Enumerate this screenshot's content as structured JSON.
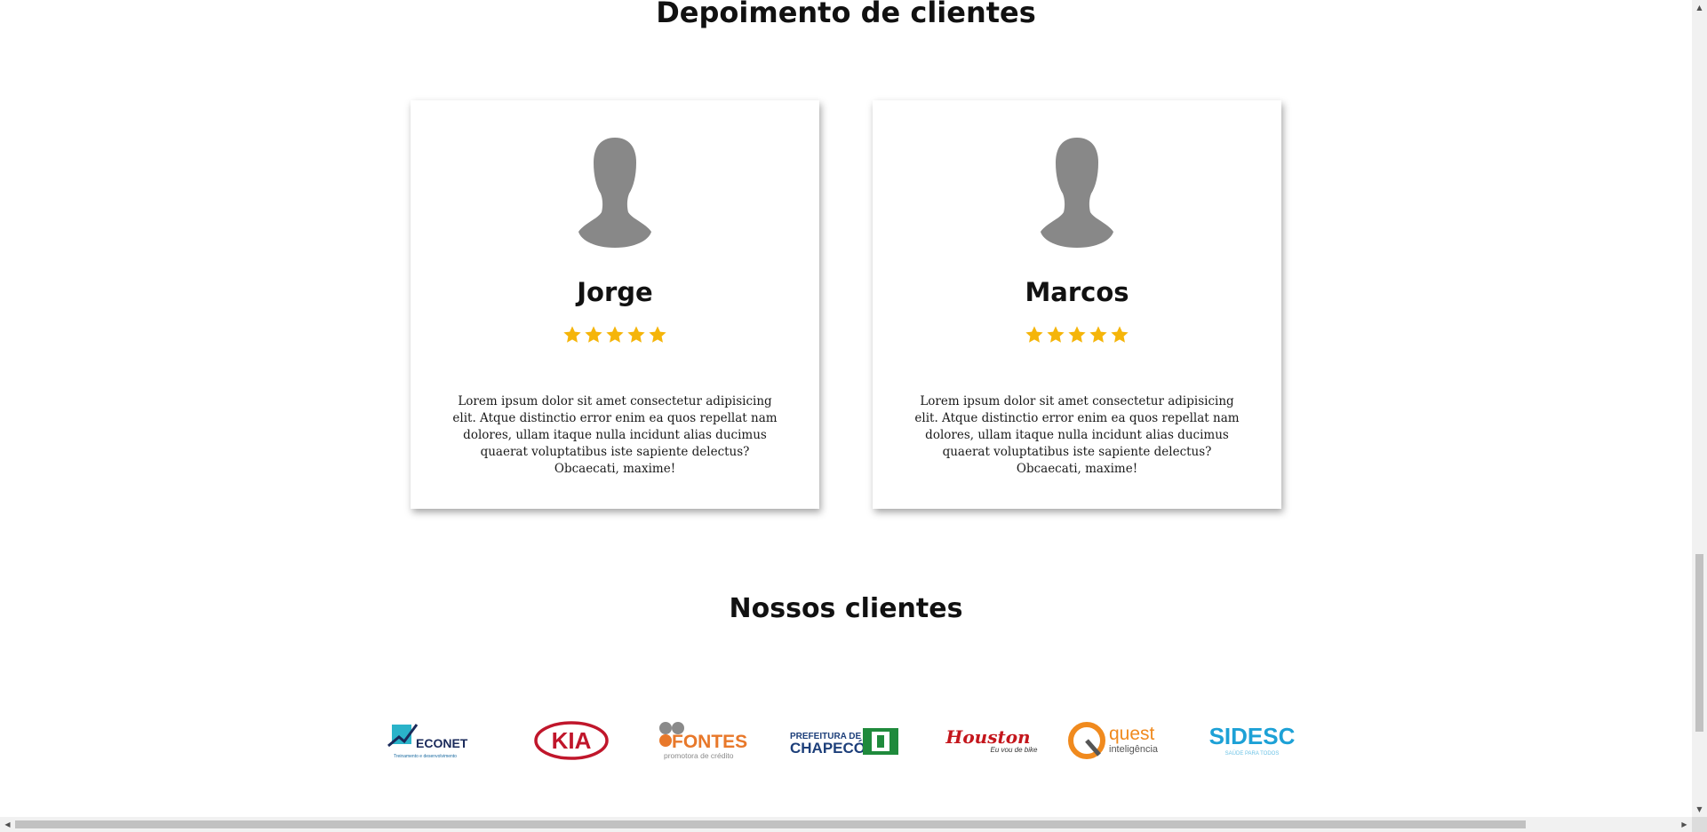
{
  "testimonials": {
    "title": "Depoimento de clientes",
    "star_color": "#f5b50a",
    "avatar_color": "#888888",
    "cards": [
      {
        "name": "Jorge",
        "rating": 5,
        "text": "Lorem ipsum dolor sit amet consectetur adipisicing elit. Atque distinctio error enim ea quos repellat nam dolores, ullam itaque nulla incidunt alias ducimus quaerat voluptatibus iste sapiente delectus? Obcaecati, maxime!"
      },
      {
        "name": "Marcos",
        "rating": 5,
        "text": "Lorem ipsum dolor sit amet consectetur adipisicing elit. Atque distinctio error enim ea quos repellat nam dolores, ullam itaque nulla incidunt alias ducimus quaerat voluptatibus iste sapiente delectus? Obcaecati, maxime!"
      }
    ]
  },
  "clients": {
    "title": "Nossos clientes",
    "logos": {
      "econet": {
        "name": "ECONET",
        "tagline": "Treinamento e desenvolvimento"
      },
      "kia": {
        "name": "KIA"
      },
      "fontes": {
        "name": "FONTES",
        "tagline": "promotora de crédito"
      },
      "chapeco": {
        "line1": "PREFEITURA DE",
        "line2": "CHAPECÓ"
      },
      "houston": {
        "name": "Houston",
        "tagline": "Eu vou de bike"
      },
      "quest": {
        "name": "quest",
        "tagline": "inteligência"
      },
      "sidesc": {
        "name": "SIDESC",
        "tagline": "SAÚDE PARA TODOS"
      }
    }
  },
  "scrollbars": {
    "vertical_position": 0.95,
    "horizontal_position": 0.0
  }
}
